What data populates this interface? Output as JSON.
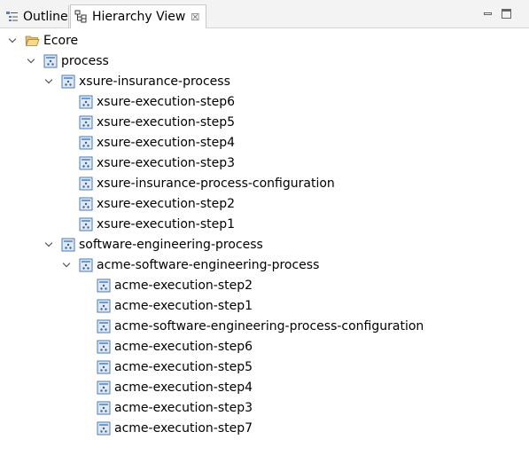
{
  "tabs": [
    {
      "label": "Outline",
      "icon": "outline-icon"
    },
    {
      "label": "Hierarchy View",
      "icon": "hierarchy-icon",
      "close": "☒"
    }
  ],
  "tree": {
    "root": "Ecore",
    "process": {
      "label": "process",
      "xsure": {
        "label": "xsure-insurance-process",
        "children": [
          "xsure-execution-step6",
          "xsure-execution-step5",
          "xsure-execution-step4",
          "xsure-execution-step3",
          "xsure-insurance-process-configuration",
          "xsure-execution-step2",
          "xsure-execution-step1"
        ]
      }
    },
    "software": {
      "label": "software-engineering-process",
      "acme": {
        "label": "acme-software-engineering-process",
        "children": [
          "acme-execution-step2",
          "acme-execution-step1",
          "acme-software-engineering-process-configuration",
          "acme-execution-step6",
          "acme-execution-step5",
          "acme-execution-step4",
          "acme-execution-step3",
          "acme-execution-step7"
        ]
      }
    }
  }
}
